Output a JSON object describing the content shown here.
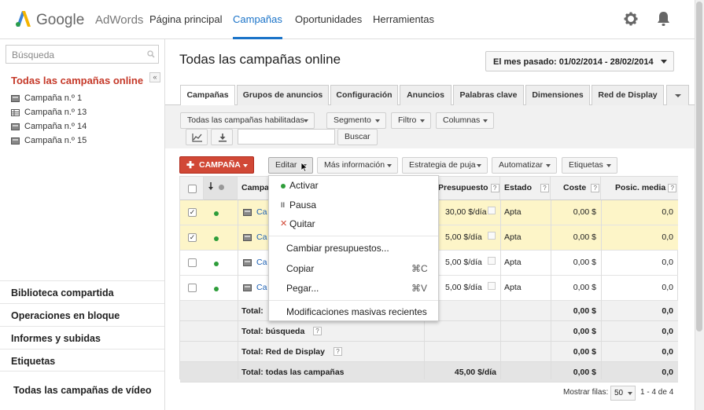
{
  "header": {
    "logo_google": "Google",
    "logo_product": "AdWords",
    "nav": [
      "Página principal",
      "Campañas",
      "Oportunidades",
      "Herramientas"
    ],
    "active_nav": "Campañas"
  },
  "sidebar": {
    "search_placeholder": "Búsqueda",
    "title": "Todas las campañas online",
    "campaigns": [
      "Campaña n.º 1",
      "Campaña n.º 13",
      "Campaña n.º 14",
      "Campaña n.º 15"
    ],
    "links": [
      "Biblioteca compartida",
      "Operaciones en bloque",
      "Informes y subidas",
      "Etiquetas"
    ],
    "video_link": "Todas las campañas de vídeo"
  },
  "main": {
    "title": "Todas las campañas online",
    "date_range": "El mes pasado: 01/02/2014 - 28/02/2014",
    "tabs": [
      "Campañas",
      "Grupos de anuncios",
      "Configuración",
      "Anuncios",
      "Palabras clave",
      "Dimensiones",
      "Red de Display"
    ],
    "filter_buttons": [
      "Todas las campañas habilitadas",
      "Segmento",
      "Filtro",
      "Columnas"
    ],
    "search_button": "Buscar",
    "new_campaign_button": "CAMPAÑA",
    "action_buttons": [
      "Editar",
      "Más información",
      "Estrategia de puja",
      "Automatizar",
      "Etiquetas"
    ]
  },
  "table": {
    "headers": {
      "campaign": "Campa",
      "budget": "Presupuesto",
      "status": "Estado",
      "cost": "Coste",
      "position": "Posic. media"
    },
    "rows": [
      {
        "name": "Ca",
        "budget": "30,00 $/día",
        "status": "Apta",
        "cost": "0,00 $",
        "position": "0,0",
        "selected": true
      },
      {
        "name": "Ca",
        "budget": "5,00 $/día",
        "status": "Apta",
        "cost": "0,00 $",
        "position": "0,0",
        "selected": true
      },
      {
        "name": "Ca",
        "budget": "5,00 $/día",
        "status": "Apta",
        "cost": "0,00 $",
        "position": "0,0",
        "selected": false
      },
      {
        "name": "Ca",
        "budget": "5,00 $/día",
        "status": "Apta",
        "cost": "0,00 $",
        "position": "0,0",
        "selected": false
      }
    ],
    "totals": [
      {
        "label": "Total:",
        "budget": "",
        "cost": "0,00 $",
        "position": "0,0"
      },
      {
        "label": "Total: búsqueda",
        "budget": "",
        "cost": "0,00 $",
        "position": "0,0"
      },
      {
        "label": "Total: Red de Display",
        "budget": "",
        "cost": "0,00 $",
        "position": "0,0"
      },
      {
        "label": "Total: todas las campañas",
        "budget": "45,00 $/día",
        "cost": "0,00 $",
        "position": "0,0"
      }
    ]
  },
  "edit_menu": {
    "items": [
      {
        "label": "Activar",
        "icon": "green-dot"
      },
      {
        "label": "Pausa",
        "icon": "pause"
      },
      {
        "label": "Quitar",
        "icon": "red-x"
      },
      {
        "label": "Cambiar presupuestos..."
      },
      {
        "label": "Copiar",
        "shortcut": "⌘C"
      },
      {
        "label": "Pegar...",
        "shortcut": "⌘V"
      },
      {
        "label": "Modificaciones masivas recientes"
      }
    ]
  },
  "footer": {
    "rows_label": "Mostrar filas:",
    "rows_value": "50",
    "range": "1 - 4 de 4"
  },
  "colors": {
    "accent_blue": "#1a73c8",
    "red": "#d14836",
    "selected_row": "#fdf5c8",
    "status_green": "#2e9d3a"
  }
}
